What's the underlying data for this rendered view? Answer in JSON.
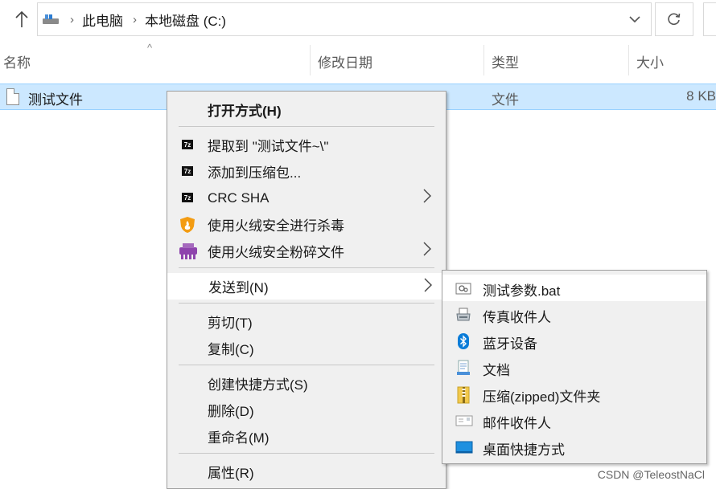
{
  "address_bar": {
    "crumbs": [
      "此电脑",
      "本地磁盘 (C:)"
    ]
  },
  "columns": {
    "name": "名称",
    "date": "修改日期",
    "type": "类型",
    "size": "大小"
  },
  "file": {
    "name": "测试文件",
    "type": "文件",
    "size": "8 KB"
  },
  "context_menu": {
    "open_with": "打开方式(H)",
    "extract_to": "提取到 \"测试文件~\\\"",
    "add_to_archive": "添加到压缩包...",
    "crc_sha": "CRC SHA",
    "scan_virus": "使用火绒安全进行杀毒",
    "shred": "使用火绒安全粉碎文件",
    "send_to": "发送到(N)",
    "cut": "剪切(T)",
    "copy": "复制(C)",
    "create_shortcut": "创建快捷方式(S)",
    "delete": "删除(D)",
    "rename": "重命名(M)",
    "properties": "属性(R)"
  },
  "send_to_menu": {
    "items": [
      {
        "label": "测试参数.bat",
        "icon": "bat-script-icon"
      },
      {
        "label": "传真收件人",
        "icon": "fax-icon"
      },
      {
        "label": "蓝牙设备",
        "icon": "bluetooth-icon"
      },
      {
        "label": "文档",
        "icon": "documents-icon"
      },
      {
        "label": "压缩(zipped)文件夹",
        "icon": "zip-folder-icon"
      },
      {
        "label": "邮件收件人",
        "icon": "mail-icon"
      },
      {
        "label": "桌面快捷方式",
        "icon": "desktop-icon"
      }
    ]
  },
  "watermark": "CSDN @TeleostNaCl",
  "colors": {
    "selection": "#cce8ff",
    "menu_bg": "#f0f0f0",
    "bluetooth": "#0a7cd8"
  }
}
